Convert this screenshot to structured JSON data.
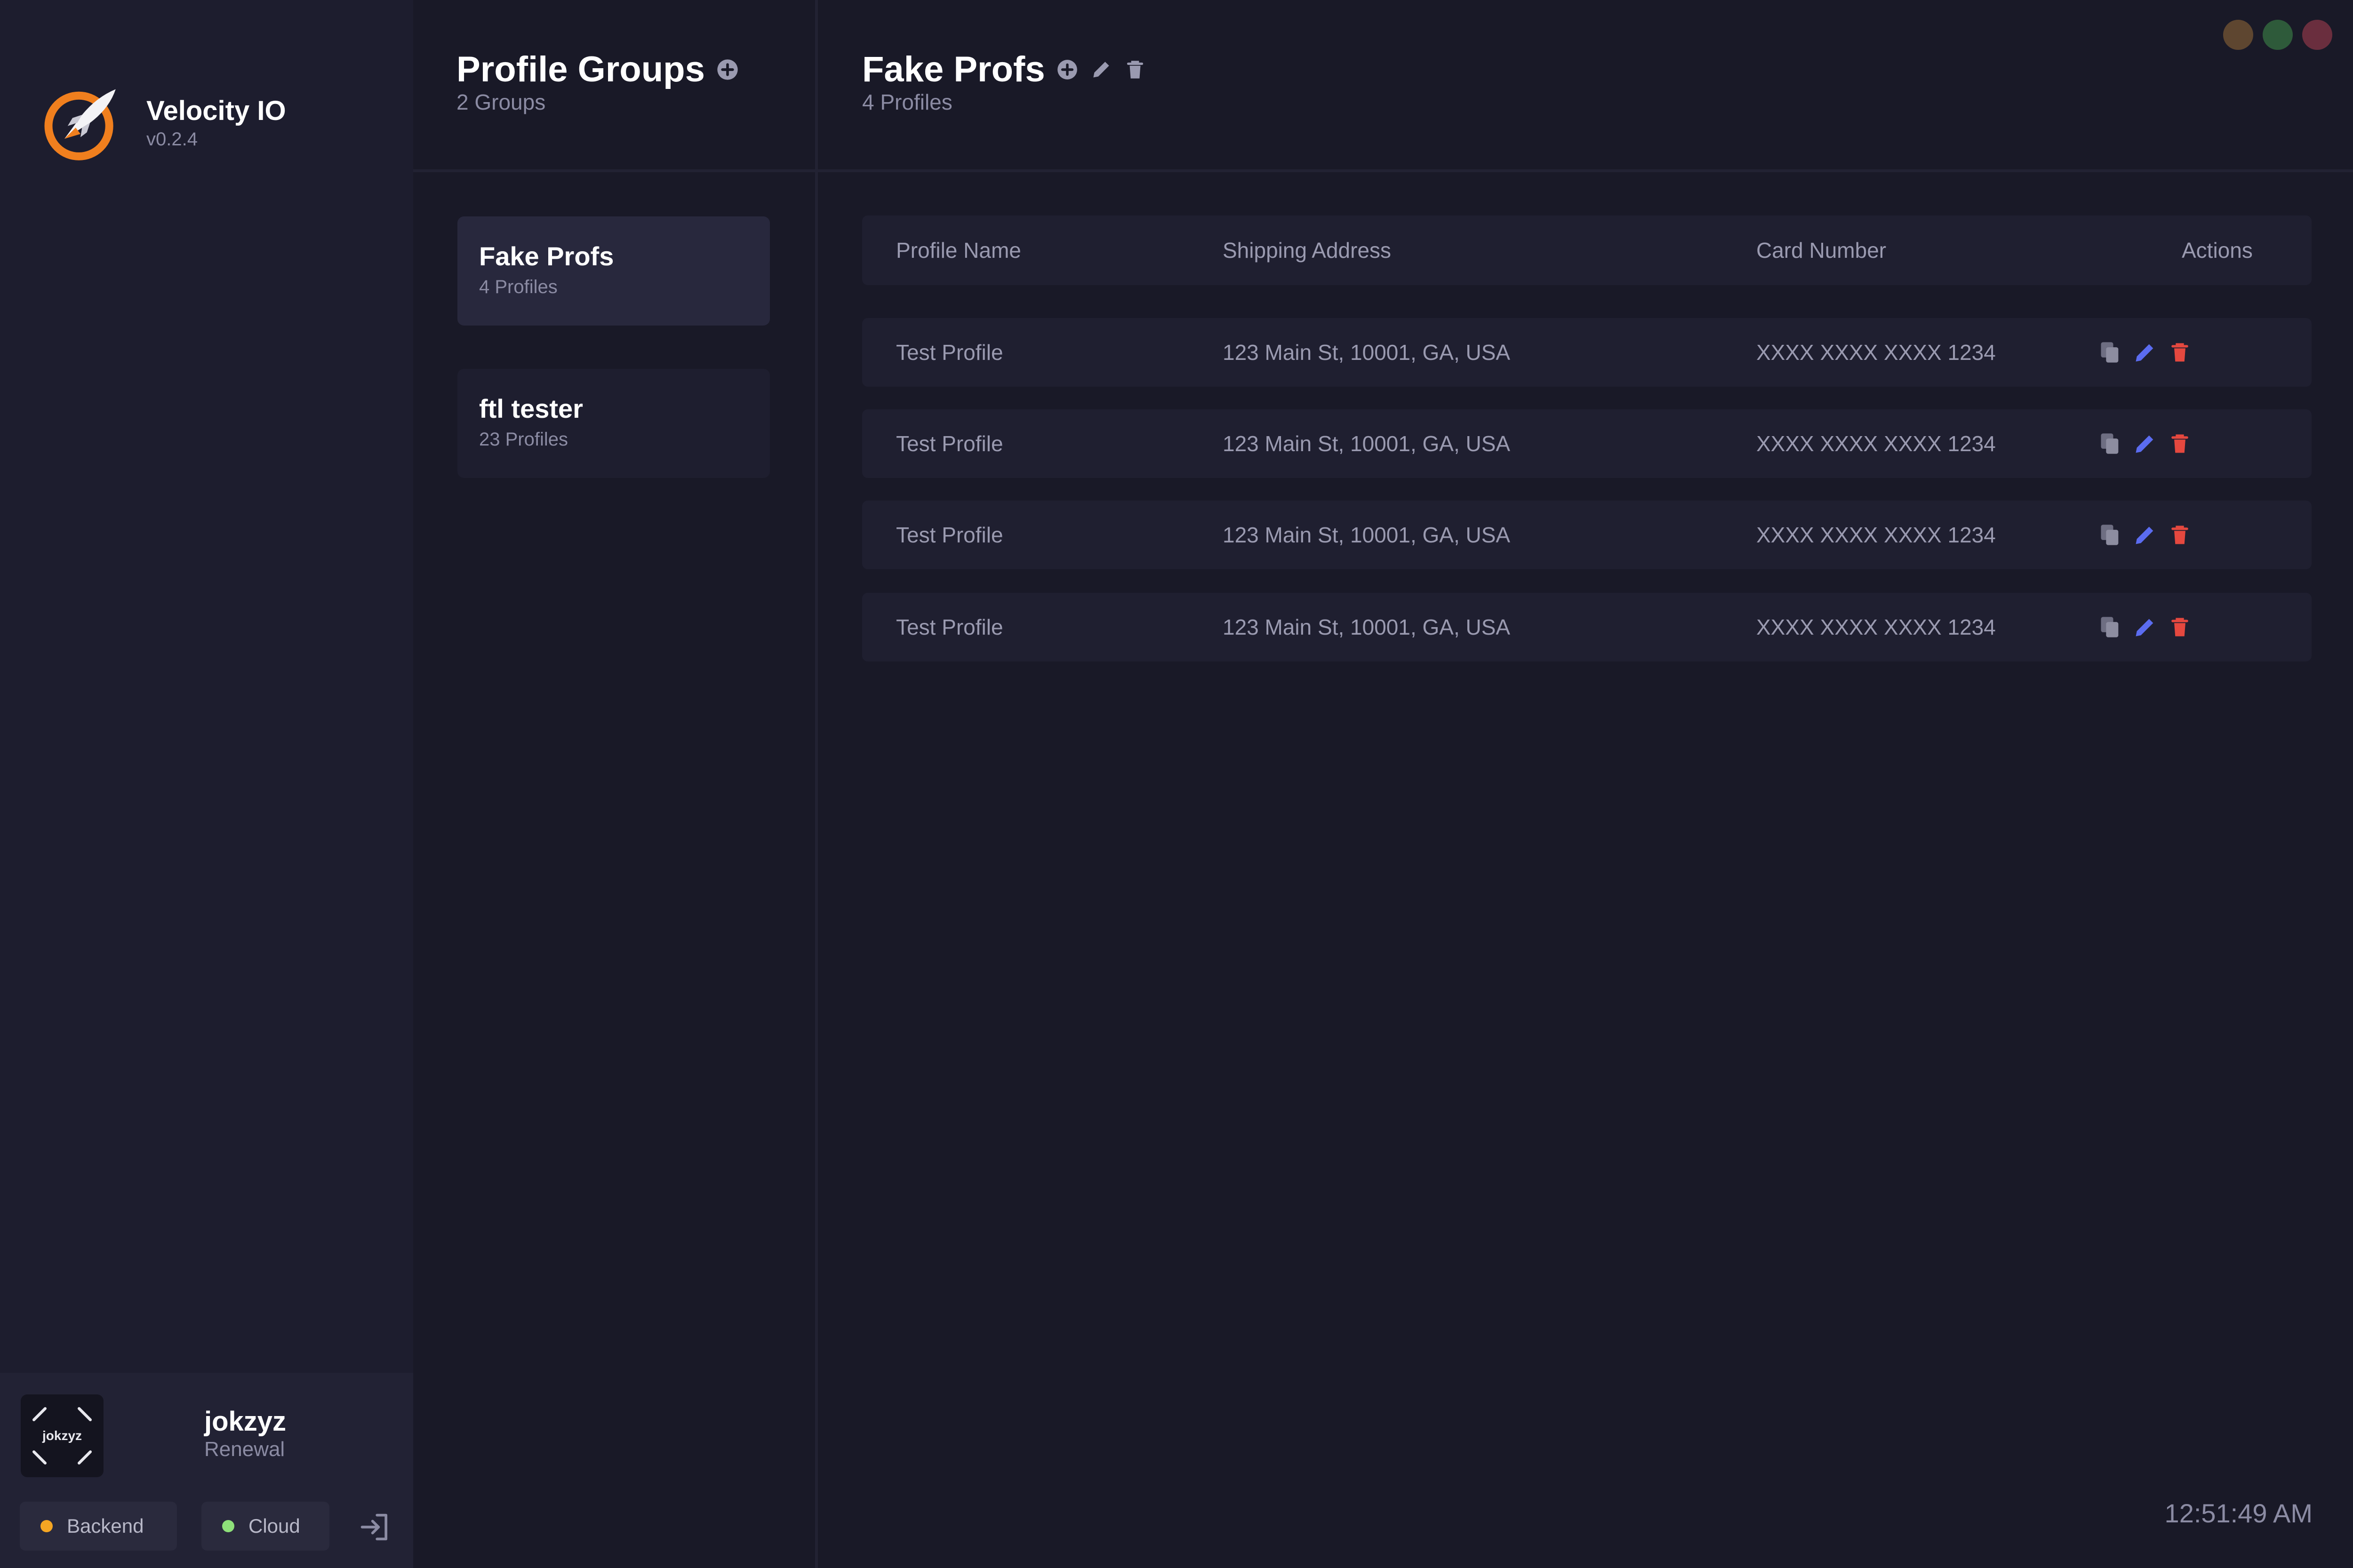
{
  "brand": {
    "name": "Velocity IO",
    "version": "v0.2.4"
  },
  "user": {
    "avatar_text": "jokzyz",
    "username": "jokzyz",
    "plan": "Renewal",
    "status": [
      {
        "label": "Backend",
        "color": "#f5a623"
      },
      {
        "label": "Cloud",
        "color": "#8ee07a"
      }
    ]
  },
  "groups_panel": {
    "title": "Profile Groups",
    "subtitle": "2 Groups",
    "groups": [
      {
        "name": "Fake Profs",
        "count": "4 Profiles"
      },
      {
        "name": "ftl tester",
        "count": "23 Profiles"
      }
    ]
  },
  "main": {
    "title": "Fake Profs",
    "subtitle": "4 Profiles",
    "columns": {
      "name": "Profile Name",
      "address": "Shipping Address",
      "card": "Card Number",
      "actions": "Actions"
    },
    "rows": [
      {
        "name": "Test Profile",
        "address": "123 Main St, 10001, GA, USA",
        "card": "XXXX XXXX XXXX 1234"
      },
      {
        "name": "Test Profile",
        "address": "123 Main St, 10001, GA, USA",
        "card": "XXXX XXXX XXXX 1234"
      },
      {
        "name": "Test Profile",
        "address": "123 Main St, 10001, GA, USA",
        "card": "XXXX XXXX XXXX 1234"
      },
      {
        "name": "Test Profile",
        "address": "123 Main St, 10001, GA, USA",
        "card": "XXXX XXXX XXXX 1234"
      }
    ]
  },
  "clock": "12:51:49 AM",
  "colors": {
    "accent_edit": "#5b6cf0",
    "accent_delete": "#e5483f",
    "logo_orange": "#f07f1e",
    "window_buttons": [
      "#5e4630",
      "#2e5a3a",
      "#6a2e3e"
    ]
  }
}
